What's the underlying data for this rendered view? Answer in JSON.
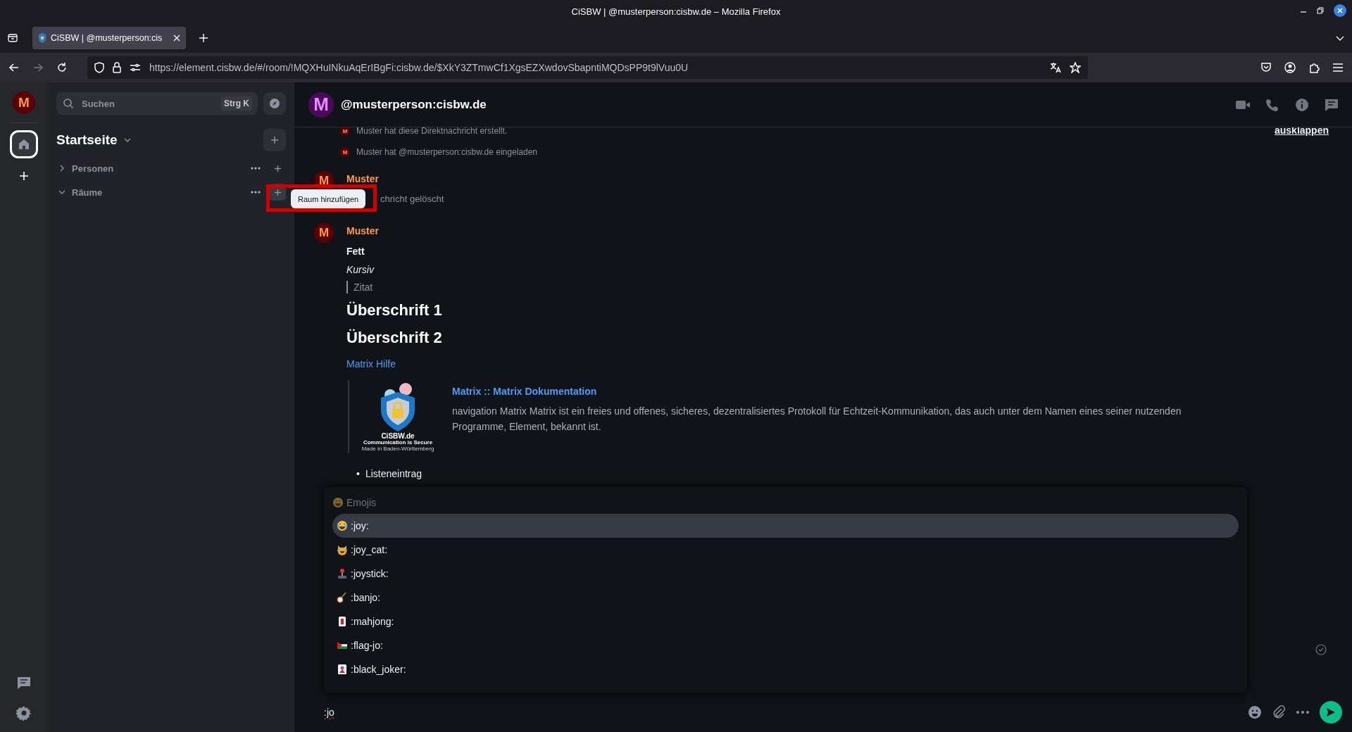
{
  "browser": {
    "window_title": "CiSBW | @musterperson:cisbw.de – Mozilla Firefox",
    "tabs": [
      {
        "label": "CiSBW | @musterperson:cis",
        "selected": true
      }
    ],
    "url": "https://element.cisbw.de/#/room/!MQXHuINkuAqErIBgFi:cisbw.de/$XkY3ZTmwCf1XgsEZXwdovSbapntiMQDsPP9t9lVuu0U"
  },
  "spaces": {
    "account_avatar": "M",
    "items": [
      {
        "kind": "home",
        "selected": true
      }
    ]
  },
  "room_list": {
    "search": {
      "placeholder": "Suchen",
      "shortcut": "Strg K"
    },
    "title": "Startseite",
    "sections": [
      {
        "label": "Personen",
        "expanded": false,
        "hovered": false
      },
      {
        "label": "Räume",
        "expanded": true,
        "hovered": true
      }
    ],
    "tooltip": "Raum hinzufügen"
  },
  "room": {
    "avatar": "M",
    "name": "@musterperson:cisbw.de",
    "expand_link": "ausklappen",
    "events": [
      {
        "kind": "state",
        "avatar": "M",
        "text": "Muster hat diese Direktnachricht erstellt."
      },
      {
        "kind": "state",
        "avatar": "M",
        "text": "Muster hat @musterperson:cisbw.de eingeladen"
      },
      {
        "kind": "message",
        "avatar": "M",
        "sender": "Muster",
        "body": [
          {
            "kind": "deleted",
            "text": "chricht gelöscht"
          }
        ]
      },
      {
        "kind": "message",
        "avatar": "M",
        "sender": "Muster",
        "body": [
          {
            "kind": "bold",
            "text": "Fett"
          },
          {
            "kind": "italic",
            "text": "Kursiv"
          },
          {
            "kind": "quote",
            "text": "Zitat"
          },
          {
            "kind": "h1",
            "text": "Überschrift 1"
          },
          {
            "kind": "h2",
            "text": "Überschrift 2"
          },
          {
            "kind": "link",
            "text": "Matrix Hilfe"
          },
          {
            "kind": "preview",
            "title": "Matrix :: Matrix Dokumentation",
            "description": "navigation Matrix Matrix ist ein freies und offenes, sicheres, dezentralisiertes Protokoll für Echtzeit-Kommunikation, das auch unter dem Namen eines seiner nutzenden Programme, Element, bekannt ist.",
            "logo_lines": [
              "CiSBW.de",
              "Communication is Secure",
              "Made in Baden-Württemberg"
            ]
          },
          {
            "kind": "list",
            "items": [
              {
                "marker": "•",
                "text": "Listeneintrag"
              }
            ]
          }
        ]
      }
    ],
    "autocomplete": {
      "header": "Emojis",
      "items": [
        {
          "kind": "joy",
          "label": ":joy:",
          "selected": true
        },
        {
          "kind": "joy_cat",
          "label": ":joy_cat:",
          "selected": false
        },
        {
          "kind": "joystick",
          "label": ":joystick:",
          "selected": false
        },
        {
          "kind": "banjo",
          "label": ":banjo:",
          "selected": false
        },
        {
          "kind": "mahjong",
          "label": ":mahjong:",
          "selected": false
        },
        {
          "kind": "flag",
          "label": ":flag-jo:",
          "selected": false
        },
        {
          "kind": "card",
          "label": ":black_joker:",
          "selected": false
        }
      ]
    },
    "composer": {
      "value": ":jo"
    }
  }
}
